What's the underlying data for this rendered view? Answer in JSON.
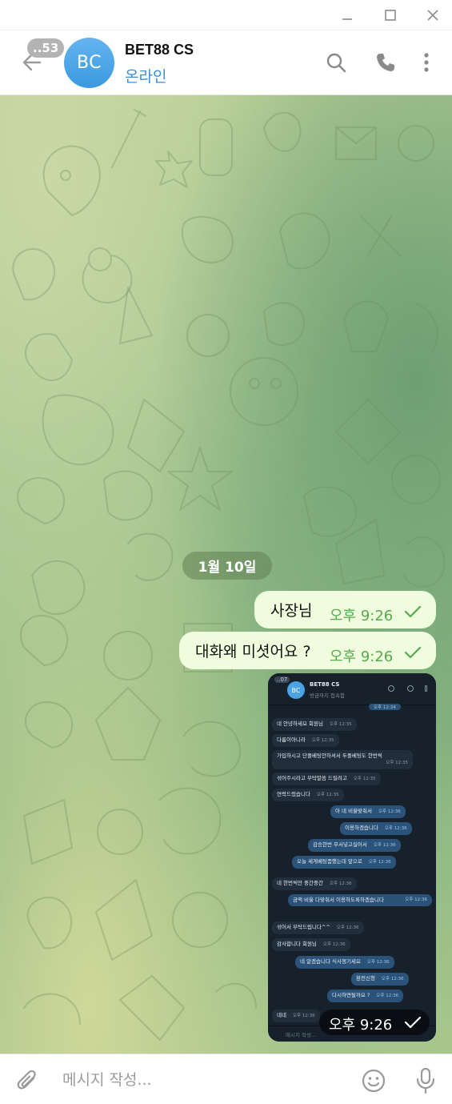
{
  "header": {
    "unread_count": "..53",
    "avatar_initials": "BC",
    "name": "BET88 CS",
    "status": "온라인"
  },
  "chat": {
    "date_label": "1월 10일",
    "messages": [
      {
        "text": "사장님",
        "time": "오후 9:26"
      },
      {
        "text": "대화왜 미셧어요 ?",
        "time": "오후 9:26"
      }
    ],
    "image_message": {
      "time": "오후 9:26",
      "screenshot": {
        "badge": "..07",
        "avatar_initials": "BC",
        "name": "BET88 CS",
        "status": "방금까지 접속함",
        "top_time": "오후 12:34",
        "messages": [
          {
            "dir": "in",
            "text": "네 안녕하세요 회원님",
            "time": "오후 12:35"
          },
          {
            "dir": "in",
            "text": "다름이아니라",
            "time": "오후 12:35"
          },
          {
            "dir": "in",
            "text": "가입하시고 단폴베팅안하셔서 두폴베팅도 한번씩",
            "time": "오후 12:35"
          },
          {
            "dir": "in",
            "text": "섞어주시라고 부탁말씀 드릴려고",
            "time": "오후 12:35"
          },
          {
            "dir": "in",
            "text": "연락드렸습니다",
            "time": "오후 12:35"
          },
          {
            "dir": "out",
            "text": "아 네 비율맞춰서",
            "time": "오후 12:36"
          },
          {
            "dir": "out",
            "text": "이용하겠습니다",
            "time": "오후 12:36"
          },
          {
            "dir": "out",
            "text": "감승한번 무서넣고실어서",
            "time": "오후 12:36"
          },
          {
            "dir": "out",
            "text": "오늘 세게베팅좀했는데 앞으로",
            "time": "오후 12:36"
          },
          {
            "dir": "in",
            "text": "네 한번씩만 중간중간",
            "time": "오후 12:36"
          },
          {
            "dir": "out",
            "text": "금액 비율 다맞춰서 이용하도록하겠습니다",
            "time": "오후 12:36"
          },
          {
            "dir": "in",
            "text": "섞어서 부탁드립니다^^",
            "time": "오후 12:36"
          },
          {
            "dir": "in",
            "text": "감사합니다 회원님",
            "time": "오후 12:36"
          },
          {
            "dir": "out",
            "text": "네 알겠습니다 식사챙기세요",
            "time": "오후 12:36"
          },
          {
            "dir": "out",
            "text": "환전신청",
            "time": "오후 12:36"
          },
          {
            "dir": "out",
            "text": "다시하면될까요 ?",
            "time": "오후 12:36"
          },
          {
            "dir": "in",
            "text": "네네",
            "time": "오후 12:36"
          }
        ],
        "input_placeholder": "메시지 작성..."
      }
    }
  },
  "input": {
    "placeholder": "메시지 작성..."
  },
  "colors": {
    "accent": "#3a8fd6",
    "bubble_out": "#effdde",
    "time_green": "#58a94d"
  },
  "icons": [
    "minimize-icon",
    "maximize-icon",
    "close-icon",
    "back-arrow-icon",
    "search-icon",
    "phone-icon",
    "more-vertical-icon",
    "check-icon",
    "attach-icon",
    "emoji-icon",
    "microphone-icon"
  ]
}
